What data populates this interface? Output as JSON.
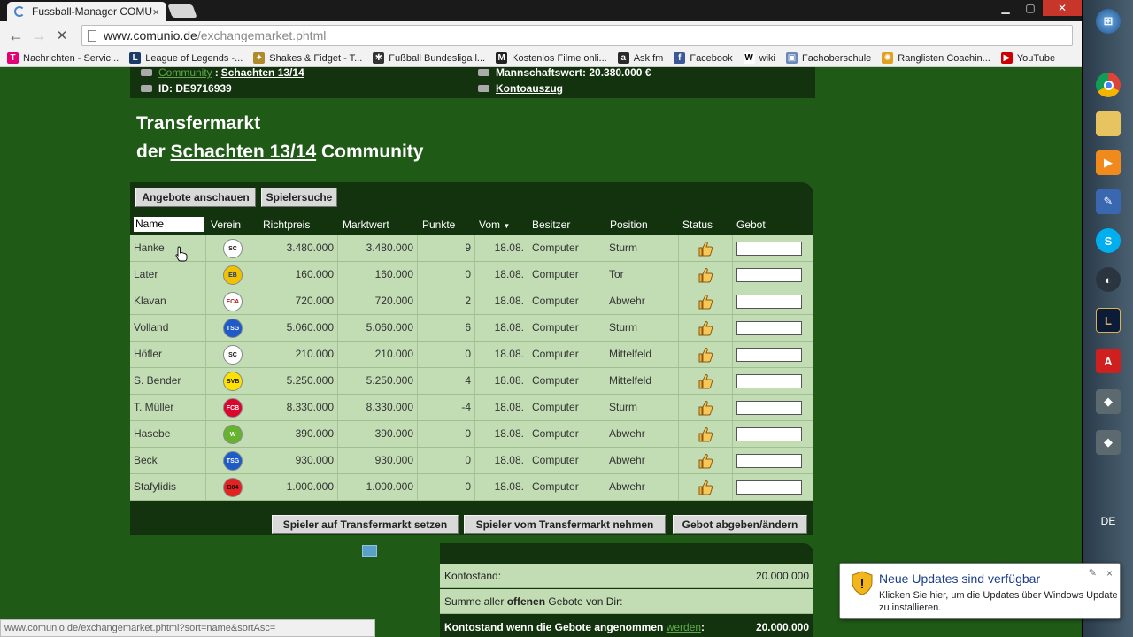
{
  "browser": {
    "tab_title": "Fussball-Manager COMU",
    "tab_close": "×",
    "url_host": "www.comunio.de",
    "url_path": "/exchangemarket.phtml",
    "back": "←",
    "forward": "→",
    "reload": "✕",
    "bookmarks": [
      {
        "label": "Nachrichten - Servic...",
        "icon": "T",
        "color": "#e20074"
      },
      {
        "label": "League of Legends -...",
        "icon": "L",
        "color": "#1a3a6a"
      },
      {
        "label": "Shakes & Fidget - T...",
        "icon": "✦",
        "color": "#b08a2a"
      },
      {
        "label": "Fußball Bundesliga l...",
        "icon": "✱",
        "color": "#333333"
      },
      {
        "label": "Kostenlos Filme onli...",
        "icon": "M",
        "color": "#222222"
      },
      {
        "label": "Ask.fm",
        "icon": "a",
        "color": "#2a2a2a"
      },
      {
        "label": "Facebook",
        "icon": "f",
        "color": "#3b5998"
      },
      {
        "label": "wiki",
        "icon": "W",
        "color": "#ffffff"
      },
      {
        "label": "Fachoberschule",
        "icon": "▣",
        "color": "#6a88b8"
      },
      {
        "label": "Ranglisten Coachin...",
        "icon": "✺",
        "color": "#e0a020"
      },
      {
        "label": "YouTube",
        "icon": "▶",
        "color": "#cc0000"
      }
    ],
    "status_url": "www.comunio.de/exchangemarket.phtml?sort=name&sortAsc="
  },
  "info": {
    "community_label": "Community",
    "community_sep": ":",
    "community_name": "Schachten 13/14",
    "id_text": "ID: DE9716939",
    "team_value": "Mannschaftswert: 20.380.000 €",
    "account_link": "Kontoauszug"
  },
  "heading": {
    "line1": "Transfermarkt",
    "prefix": "der",
    "community": "Schachten 13/14",
    "suffix": "Community"
  },
  "buttons": {
    "view_offers": "Angebote anschauen",
    "player_search": "Spielersuche",
    "put_on_market": "Spieler auf Transfermarkt setzen",
    "take_off_market": "Spieler vom Transfermarkt nehmen",
    "place_bid": "Gebot abgeben/ändern"
  },
  "columns": {
    "name": "Name",
    "club": "Verein",
    "guide_price": "Richtpreis",
    "market_value": "Marktwert",
    "points": "Punkte",
    "from": "Vom",
    "owner": "Besitzer",
    "position": "Position",
    "status": "Status",
    "bid": "Gebot"
  },
  "players": [
    {
      "name": "Hanke",
      "club": "freiburg",
      "guide": "3.480.000",
      "value": "3.480.000",
      "points": "9",
      "from": "18.08.",
      "owner": "Computer",
      "position": "Sturm"
    },
    {
      "name": "Later",
      "club": "braunschweig",
      "guide": "160.000",
      "value": "160.000",
      "points": "0",
      "from": "18.08.",
      "owner": "Computer",
      "position": "Tor"
    },
    {
      "name": "Klavan",
      "club": "augsburg",
      "guide": "720.000",
      "value": "720.000",
      "points": "2",
      "from": "18.08.",
      "owner": "Computer",
      "position": "Abwehr"
    },
    {
      "name": "Volland",
      "club": "hoffenheim",
      "guide": "5.060.000",
      "value": "5.060.000",
      "points": "6",
      "from": "18.08.",
      "owner": "Computer",
      "position": "Sturm"
    },
    {
      "name": "Höfler",
      "club": "freiburg",
      "guide": "210.000",
      "value": "210.000",
      "points": "0",
      "from": "18.08.",
      "owner": "Computer",
      "position": "Mittelfeld"
    },
    {
      "name": "S. Bender",
      "club": "dortmund",
      "guide": "5.250.000",
      "value": "5.250.000",
      "points": "4",
      "from": "18.08.",
      "owner": "Computer",
      "position": "Mittelfeld"
    },
    {
      "name": "T. Müller",
      "club": "bayern",
      "guide": "8.330.000",
      "value": "8.330.000",
      "points": "-4",
      "from": "18.08.",
      "owner": "Computer",
      "position": "Sturm"
    },
    {
      "name": "Hasebe",
      "club": "wolfsburg",
      "guide": "390.000",
      "value": "390.000",
      "points": "0",
      "from": "18.08.",
      "owner": "Computer",
      "position": "Abwehr"
    },
    {
      "name": "Beck",
      "club": "hoffenheim",
      "guide": "930.000",
      "value": "930.000",
      "points": "0",
      "from": "18.08.",
      "owner": "Computer",
      "position": "Abwehr"
    },
    {
      "name": "Stafylidis",
      "club": "leverkusen",
      "guide": "1.000.000",
      "value": "1.000.000",
      "points": "0",
      "from": "18.08.",
      "owner": "Computer",
      "position": "Abwehr"
    }
  ],
  "club_crests": {
    "freiburg": {
      "color": "#ffffff",
      "fg": "#111111",
      "text": "SC"
    },
    "braunschweig": {
      "color": "#f2c200",
      "fg": "#1a3a8a",
      "text": "EB"
    },
    "augsburg": {
      "color": "#ffffff",
      "fg": "#b02020",
      "text": "FCA"
    },
    "hoffenheim": {
      "color": "#1e5bc6",
      "fg": "#ffffff",
      "text": "TSG"
    },
    "dortmund": {
      "color": "#fde100",
      "fg": "#111111",
      "text": "BVB"
    },
    "bayern": {
      "color": "#dc052d",
      "fg": "#ffffff",
      "text": "FCB"
    },
    "wolfsburg": {
      "color": "#65b32e",
      "fg": "#ffffff",
      "text": "W"
    },
    "leverkusen": {
      "color": "#e32221",
      "fg": "#111111",
      "text": "B04"
    }
  },
  "konto": {
    "balance_label": "Kontostand:",
    "balance_value": "20.000.000",
    "bids_prefix": "Summe aller ",
    "bids_bold": "offenen",
    "bids_suffix": " Gebote von Dir:",
    "after_prefix": "Kontostand wenn die Gebote angenommen ",
    "after_link": "werden",
    "after_suffix": ":",
    "after_value": "20.000.000"
  },
  "notification": {
    "title": "Neue Updates sind verfügbar",
    "body": "Klicken Sie hier, um die Updates über Windows Update zu installieren.",
    "close": "×"
  },
  "taskbar": {
    "lang": "DE"
  }
}
